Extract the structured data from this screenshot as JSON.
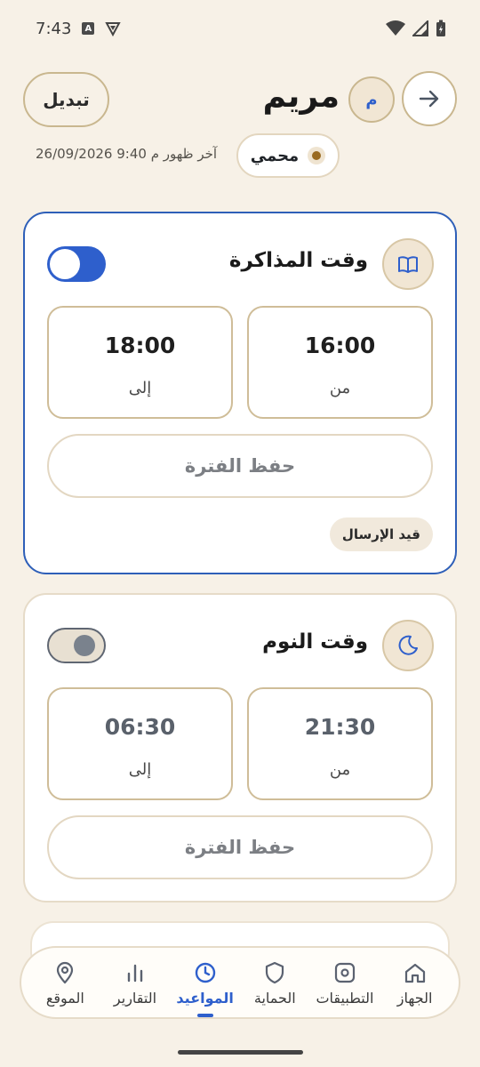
{
  "status_bar": {
    "time": "7:43",
    "left_icons": [
      "text-badge-icon",
      "shield-notification-icon"
    ],
    "right_icons": [
      "wifi-icon",
      "signal-icon",
      "battery-charging-icon"
    ]
  },
  "header": {
    "switch_label": "تبديل",
    "child_name": "مريم",
    "avatar_initial": "م",
    "status_label": "محمي",
    "last_seen": "آخر ظهور م 9:40 26/09/2026"
  },
  "schedules": [
    {
      "title": "وقت المذاكرة",
      "icon": "book-icon",
      "enabled": true,
      "from_label": "من",
      "from_time": "16:00",
      "to_label": "إلى",
      "to_time": "18:00",
      "save_label": "حفظ الفترة",
      "badge": "قيد الإرسال"
    },
    {
      "title": "وقت النوم",
      "icon": "moon-icon",
      "enabled": false,
      "from_label": "من",
      "from_time": "21:30",
      "to_label": "إلى",
      "to_time": "06:30",
      "save_label": "حفظ الفترة"
    }
  ],
  "nav": {
    "items": [
      {
        "label": "الجهاز",
        "icon": "home-icon"
      },
      {
        "label": "التطبيقات",
        "icon": "apps-icon"
      },
      {
        "label": "الحماية",
        "icon": "shield-icon"
      },
      {
        "label": "المواعيد",
        "icon": "clock-icon"
      },
      {
        "label": "التقارير",
        "icon": "bar-chart-icon"
      },
      {
        "label": "الموقع",
        "icon": "location-pin-icon"
      }
    ],
    "active": "المواعيد"
  },
  "colors": {
    "accent": "#2e5fcc",
    "background": "#f7f1e7",
    "border": "#cfbd98"
  }
}
